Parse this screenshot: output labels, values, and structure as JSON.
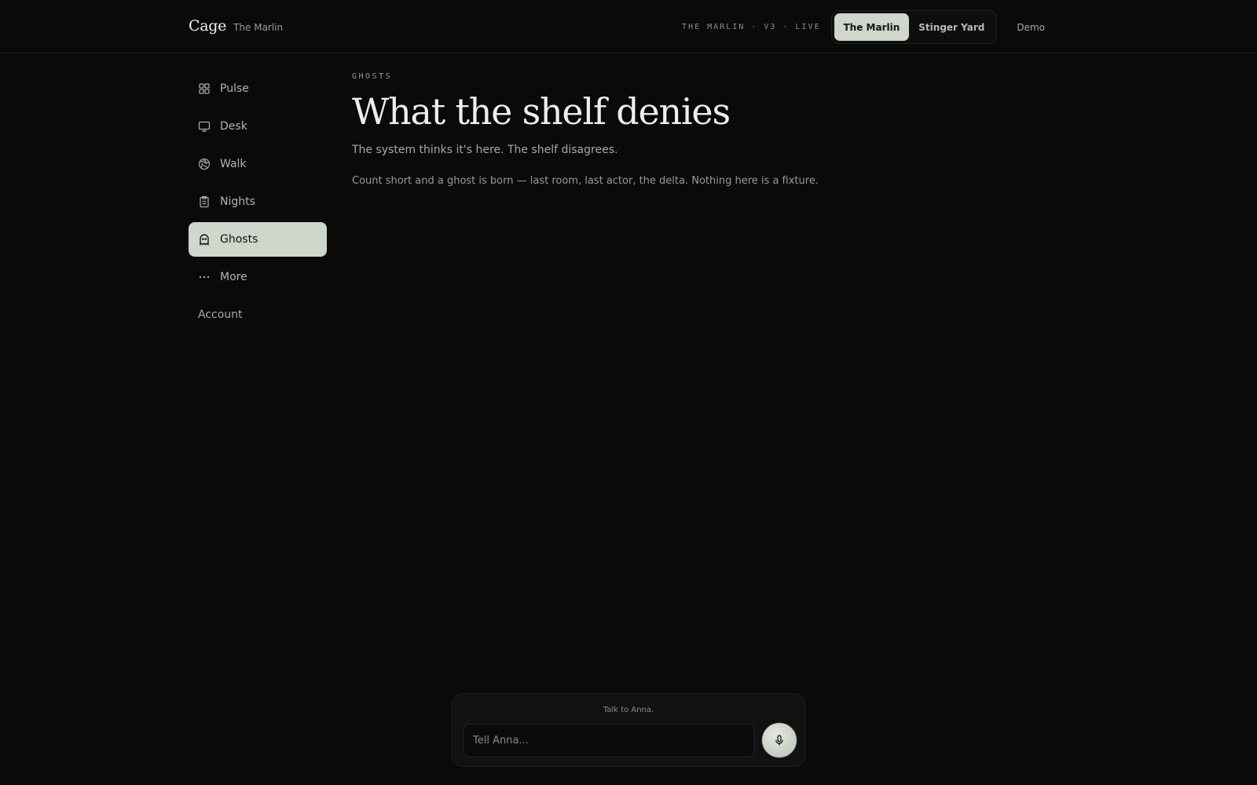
{
  "header": {
    "brand": "Cage",
    "brand_sub": "The Marlin",
    "status": "THE MARLIN · V3 · LIVE",
    "sites": [
      {
        "label": "The Marlin",
        "active": true
      },
      {
        "label": "Stinger Yard",
        "active": false
      }
    ],
    "demo_label": "Demo"
  },
  "sidebar": {
    "items": [
      {
        "label": "Pulse",
        "icon": "grid-icon",
        "active": false
      },
      {
        "label": "Desk",
        "icon": "monitor-icon",
        "active": false
      },
      {
        "label": "Walk",
        "icon": "aperture-icon",
        "active": false
      },
      {
        "label": "Nights",
        "icon": "clipboard-icon",
        "active": false
      },
      {
        "label": "Ghosts",
        "icon": "ghost-icon",
        "active": true
      },
      {
        "label": "More",
        "icon": "more-icon",
        "active": false
      }
    ],
    "account_label": "Account"
  },
  "main": {
    "eyebrow": "GHOSTS",
    "title": "What the shelf denies",
    "subtitle": "The system thinks it's here. The shelf disagrees.",
    "body": "Count short and a ghost is born — last room, last actor, the delta. Nothing here is a fixture."
  },
  "composer": {
    "label": "Talk to Anna.",
    "placeholder": "Tell Anna...",
    "value": ""
  },
  "colors": {
    "background": "#0a0a0a",
    "accent": "#cfd6cc"
  }
}
